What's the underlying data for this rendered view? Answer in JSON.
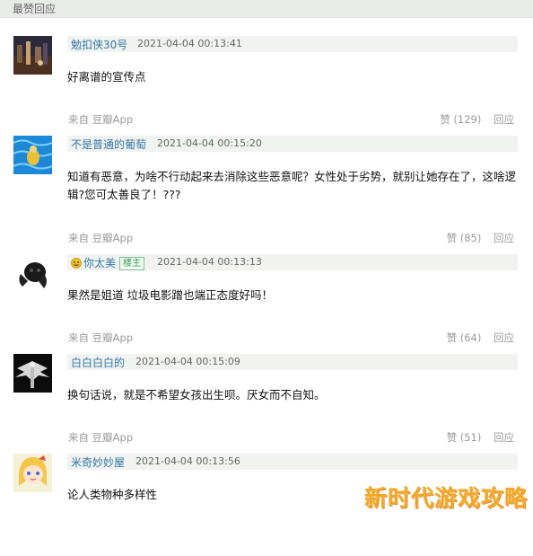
{
  "section_title": "最赞回应",
  "comments": [
    {
      "author": "勉扣侠30号",
      "time": "2021-04-04 00:13:41",
      "text": "好离谱的宣传点",
      "avatar_icon": "avatar-dark-city-icon",
      "owner_badge": null
    },
    {
      "source": "来自 豆瓣App",
      "votes": "赞 (129)",
      "reply": "回应",
      "author": "不是普通的葡萄",
      "time": "2021-04-04 00:15:20",
      "text": "知道有恶意，为啥不行动起来去消除这些恶意呢？女性处于劣势，就别让她存在了，这啥逻辑?您可太善良了！???",
      "avatar_icon": "avatar-pool-icon",
      "owner_badge": null
    },
    {
      "source": "来自 豆瓣App",
      "votes": "赞 (85)",
      "reply": "回应",
      "author": "你太美",
      "time": "2021-04-04 00:13:13",
      "text": "果然是姐道 垃圾电影蹭也端正态度好吗！",
      "avatar_icon": "avatar-black-figure-icon",
      "owner_badge": "楼主"
    },
    {
      "source": "来自 豆瓣App",
      "votes": "赞 (64)",
      "reply": "回应",
      "author": "白白白白的",
      "time": "2021-04-04 00:15:09",
      "text": "换句话说，就是不希望女孩出生呗。厌女而不自知。",
      "avatar_icon": "avatar-winged-figure-icon",
      "owner_badge": null
    },
    {
      "source": "来自 豆瓣App",
      "votes": "赞 (51)",
      "reply": "回应",
      "author": "米奇妙妙屋",
      "time": "2021-04-04 00:13:56",
      "text": "论人类物种多样性",
      "avatar_icon": "avatar-anime-girl-icon",
      "owner_badge": null
    }
  ],
  "watermark": "新时代游戏攻略",
  "colors": {
    "author_link": "#3377aa",
    "header_bg": "#f0f3ef",
    "meta_text": "#9a9a9a",
    "badge_green": "#3e9a52",
    "watermark": "#f5a623"
  }
}
